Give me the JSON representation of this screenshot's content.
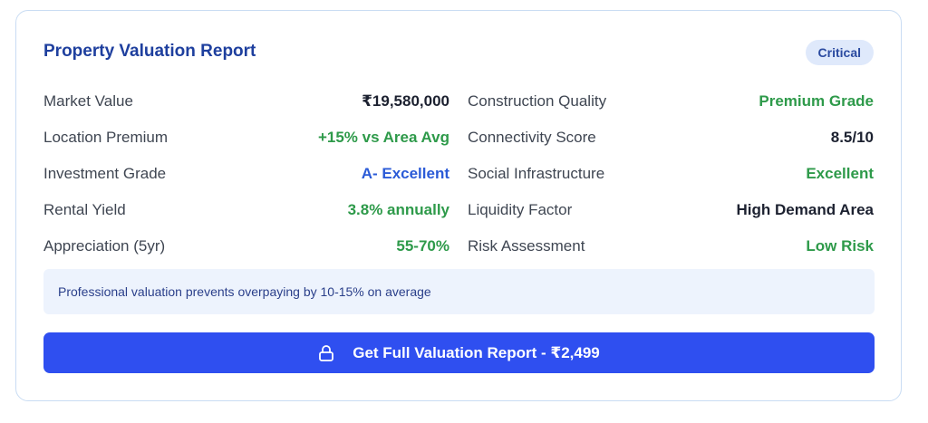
{
  "report": {
    "title": "Property Valuation Report",
    "badge": "Critical",
    "left_rows": [
      {
        "label": "Market Value",
        "value": "₹19,580,000"
      },
      {
        "label": "Location Premium",
        "value": "+15% vs Area Avg"
      },
      {
        "label": "Investment Grade",
        "value": "A- Excellent"
      },
      {
        "label": "Rental Yield",
        "value": "3.8% annually"
      },
      {
        "label": "Appreciation (5yr)",
        "value": "55-70%"
      }
    ],
    "right_rows": [
      {
        "label": "Construction Quality",
        "value": "Premium Grade"
      },
      {
        "label": "Connectivity Score",
        "value": "8.5/10"
      },
      {
        "label": "Social Infrastructure",
        "value": "Excellent"
      },
      {
        "label": "Liquidity Factor",
        "value": "High Demand Area"
      },
      {
        "label": "Risk Assessment",
        "value": "Low Risk"
      }
    ],
    "note": "Professional valuation prevents overpaying by 10-15% on average",
    "cta": {
      "label": "Get Full Valuation Report - ₹2,499",
      "icon": "lock-icon"
    }
  },
  "colors": {
    "accent": "#2f4ff0",
    "title": "#1e3f9e",
    "positive": "#2e9a4a",
    "info": "#2b5bd7",
    "badge_bg": "#dfe9fb",
    "note_bg": "#edf3fd"
  }
}
